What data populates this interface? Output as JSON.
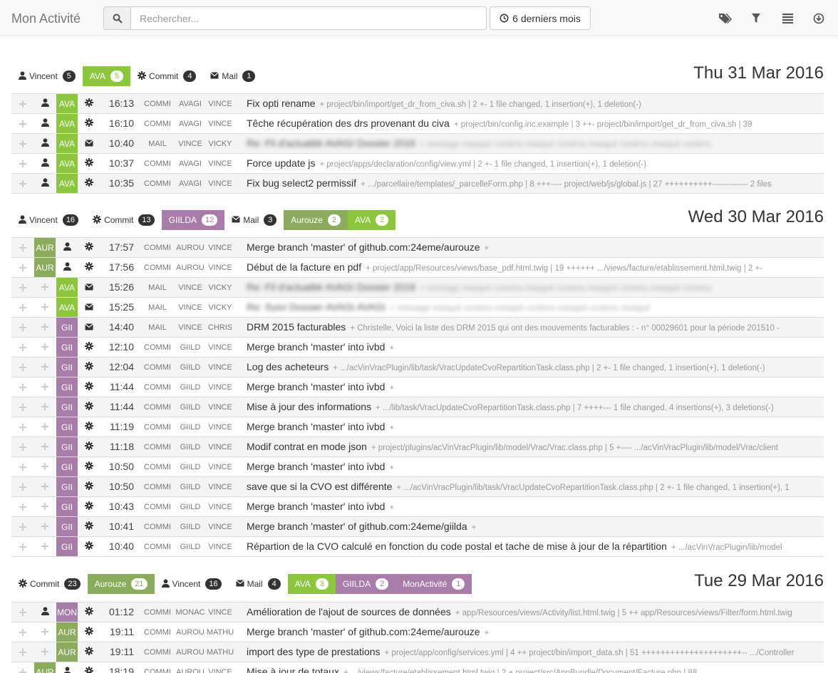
{
  "colors": {
    "AVA": "#8cc63f",
    "AUR": "#8aac5c",
    "GII": "#a87ca8",
    "MON": "#a87ca8"
  },
  "navbar": {
    "brand": "Mon Activité",
    "search_placeholder": "Rechercher...",
    "period_label": "6 derniers mois",
    "icons": [
      "tags-icon",
      "filter-icon",
      "list-icon",
      "download-icon"
    ]
  },
  "sections": [
    {
      "date": "Thu 31 Mar 2016",
      "summary": [
        {
          "icon": "user-icon",
          "label": "Vincent",
          "count": "5",
          "color": ""
        },
        {
          "icon": "",
          "label": "AVA",
          "count": "5",
          "color": "#8cc63f"
        },
        {
          "icon": "gear-icon",
          "label": "Commit",
          "count": "4",
          "color": ""
        },
        {
          "icon": "mail-icon",
          "label": "Mail",
          "count": "1",
          "color": ""
        }
      ],
      "rows": [
        {
          "cols": [
            "user",
            "AVA",
            "gear"
          ],
          "time": "16:13",
          "t1": "COMMI",
          "t2": "AVAGI",
          "t3": "VINCE",
          "title": "Fix opti rename",
          "detail": "+ project/bin/import/get_dr_from_civa.sh | 2 +- 1 file changed, 1 insertion(+), 1 deletion(-)",
          "blur": false
        },
        {
          "cols": [
            "user",
            "AVA",
            "gear"
          ],
          "time": "16:10",
          "t1": "COMMI",
          "t2": "AVAGI",
          "t3": "VINCE",
          "title": "Têche récupération des drs provenant du civa",
          "detail": "+ project/bin/config.inc.example | 3 ++- project/bin/import/get_dr_from_civa.sh | 39",
          "blur": false
        },
        {
          "cols": [
            "user",
            "AVA",
            "mail"
          ],
          "time": "10:40",
          "t1": "MAIL",
          "t2": "VINCE",
          "t3": "VICKY",
          "title": "Re: Fil d'actualité AVAGI Dossier 2016",
          "detail": "+ message masqué contenu masqué contenu masqué contenu masqué contenu",
          "blur": true
        },
        {
          "cols": [
            "user",
            "AVA",
            "gear"
          ],
          "time": "10:37",
          "t1": "COMMI",
          "t2": "AVAGI",
          "t3": "VINCE",
          "title": "Force update js",
          "detail": "+ project/apps/declaration/config/view.yml | 2 +- 1 file changed, 1 insertion(+), 1 deletion(-)",
          "blur": false
        },
        {
          "cols": [
            "user",
            "AVA",
            "gear"
          ],
          "time": "10:35",
          "t1": "COMMI",
          "t2": "AVAGI",
          "t3": "VINCE",
          "title": "Fix bug select2 permissif",
          "detail": "+ .../parcellaire/templates/_parcelleForm.php | 8 +++---- project/web/js/global.js | 27 ++++++++++------------- 2 files",
          "blur": false
        }
      ]
    },
    {
      "date": "Wed 30 Mar 2016",
      "summary": [
        {
          "icon": "user-icon",
          "label": "Vincent",
          "count": "16",
          "color": ""
        },
        {
          "icon": "gear-icon",
          "label": "Commit",
          "count": "13",
          "color": ""
        },
        {
          "icon": "",
          "label": "GIILDA",
          "count": "12",
          "color": "#a87ca8"
        },
        {
          "icon": "mail-icon",
          "label": "Mail",
          "count": "3",
          "color": ""
        },
        {
          "icon": "",
          "label": "Aurouze",
          "count": "2",
          "color": "#8aac5c"
        },
        {
          "icon": "",
          "label": "AVA",
          "count": "2",
          "color": "#8cc63f"
        }
      ],
      "rows": [
        {
          "cols": [
            "AUR",
            "user",
            "gear"
          ],
          "time": "17:57",
          "t1": "COMMI",
          "t2": "AUROU",
          "t3": "VINCE",
          "title": "Merge branch 'master' of github.com:24eme/aurouze",
          "detail": "+",
          "blur": false
        },
        {
          "cols": [
            "AUR",
            "user",
            "gear"
          ],
          "time": "17:56",
          "t1": "COMMI",
          "t2": "AUROU",
          "t3": "VINCE",
          "title": "Début de la facture en pdf",
          "detail": "+ project/app/Resources/views/base_pdf.html.twig | 19 ++++++ .../views/facture/etablissement.html.twig | 2 +-",
          "blur": false
        },
        {
          "cols": [
            "plus",
            "AVA",
            "mail"
          ],
          "time": "15:26",
          "t1": "MAIL",
          "t2": "VINCE",
          "t3": "VICKY",
          "title": "Re: Fil d'actualité AVAGI Dossier 2016",
          "detail": "+ message masqué contenu masqué contenu masqué contenu masqué contenu",
          "blur": true
        },
        {
          "cols": [
            "plus",
            "AVA",
            "mail"
          ],
          "time": "15:25",
          "t1": "MAIL",
          "t2": "VINCE",
          "t3": "VICKY",
          "title": "Re: Suivi Dossier AVAGI AVAGI",
          "detail": "+ message masqué contenu masqué contenu masqué contenu masqué",
          "blur": true
        },
        {
          "cols": [
            "plus",
            "GII",
            "mail"
          ],
          "time": "14:40",
          "t1": "MAIL",
          "t2": "VINCE",
          "t3": "CHRIS",
          "title": "DRM 2015 facturables",
          "detail": "+ Christelle, Voici la liste des DRM 2015 qui ont des mouvements facturables : - n° 00029601 pour la période 201510 -",
          "blur": false
        },
        {
          "cols": [
            "plus",
            "GII",
            "gear"
          ],
          "time": "12:10",
          "t1": "COMMI",
          "t2": "GIILD",
          "t3": "VINCE",
          "title": "Merge branch 'master' into ivbd",
          "detail": "+",
          "blur": false
        },
        {
          "cols": [
            "plus",
            "GII",
            "gear"
          ],
          "time": "12:04",
          "t1": "COMMI",
          "t2": "GIILD",
          "t3": "VINCE",
          "title": "Log des acheteurs",
          "detail": "+ .../acVinVracPlugin/lib/task/VracUpdateCvoRepartitionTask.class.php | 2 +- 1 file changed, 1 insertion(+), 1 deletion(-)",
          "blur": false
        },
        {
          "cols": [
            "plus",
            "GII",
            "gear"
          ],
          "time": "11:44",
          "t1": "COMMI",
          "t2": "GIILD",
          "t3": "VINCE",
          "title": "Merge branch 'master' into ivbd",
          "detail": "+",
          "blur": false
        },
        {
          "cols": [
            "plus",
            "GII",
            "gear"
          ],
          "time": "11:44",
          "t1": "COMMI",
          "t2": "GIILD",
          "t3": "VINCE",
          "title": "Mise à jour des informations",
          "detail": "+ .../lib/task/VracUpdateCvoRepartitionTask.class.php | 7 ++++--- 1 file changed, 4 insertions(+), 3 deletions(-)",
          "blur": false
        },
        {
          "cols": [
            "plus",
            "GII",
            "gear"
          ],
          "time": "11:19",
          "t1": "COMMI",
          "t2": "GIILD",
          "t3": "VINCE",
          "title": "Merge branch 'master' into ivbd",
          "detail": "+",
          "blur": false
        },
        {
          "cols": [
            "plus",
            "GII",
            "gear"
          ],
          "time": "11:18",
          "t1": "COMMI",
          "t2": "GIILD",
          "t3": "VINCE",
          "title": "Modif contrat en mode json",
          "detail": "+ project/plugins/acVinVracPlugin/lib/model/Vrac/Vrac.class.php | 5 +---- .../acVinVracPlugin/lib/model/Vrac/client",
          "blur": false
        },
        {
          "cols": [
            "plus",
            "GII",
            "gear"
          ],
          "time": "10:50",
          "t1": "COMMI",
          "t2": "GIILD",
          "t3": "VINCE",
          "title": "Merge branch 'master' into ivbd",
          "detail": "+",
          "blur": false
        },
        {
          "cols": [
            "plus",
            "GII",
            "gear"
          ],
          "time": "10:50",
          "t1": "COMMI",
          "t2": "GIILD",
          "t3": "VINCE",
          "title": "save que si la CVO est différente",
          "detail": "+ .../acVinVracPlugin/lib/task/VracUpdateCvoRepartitionTask.class.php | 2 +- 1 file changed, 1 insertion(+), 1",
          "blur": false
        },
        {
          "cols": [
            "plus",
            "GII",
            "gear"
          ],
          "time": "10:43",
          "t1": "COMMI",
          "t2": "GIILD",
          "t3": "VINCE",
          "title": "Merge branch 'master' into ivbd",
          "detail": "+",
          "blur": false
        },
        {
          "cols": [
            "plus",
            "GII",
            "gear"
          ],
          "time": "10:41",
          "t1": "COMMI",
          "t2": "GIILD",
          "t3": "VINCE",
          "title": "Merge branch 'master' of github.com:24eme/giilda",
          "detail": "+",
          "blur": false
        },
        {
          "cols": [
            "plus",
            "GII",
            "gear"
          ],
          "time": "10:40",
          "t1": "COMMI",
          "t2": "GIILD",
          "t3": "VINCE",
          "title": "Répartion de la CVO calculé en fonction du code postal et tache de mise à jour de la répartition",
          "detail": "+ .../acVinVracPlugin/lib/model",
          "blur": false
        }
      ]
    },
    {
      "date": "Tue 29 Mar 2016",
      "summary": [
        {
          "icon": "gear-icon",
          "label": "Commit",
          "count": "23",
          "color": ""
        },
        {
          "icon": "",
          "label": "Aurouze",
          "count": "21",
          "color": "#8aac5c"
        },
        {
          "icon": "user-icon",
          "label": "Vincent",
          "count": "16",
          "color": ""
        },
        {
          "icon": "mail-icon",
          "label": "Mail",
          "count": "4",
          "color": ""
        },
        {
          "icon": "",
          "label": "AVA",
          "count": "3",
          "color": "#8cc63f"
        },
        {
          "icon": "",
          "label": "GIILDA",
          "count": "2",
          "color": "#a87ca8"
        },
        {
          "icon": "",
          "label": "MonActivité",
          "count": "1",
          "color": "#a87ca8"
        }
      ],
      "rows": [
        {
          "cols": [
            "user",
            "MON",
            "gear"
          ],
          "time": "01:12",
          "t1": "COMMI",
          "t2": "MONAC",
          "t3": "VINCE",
          "title": "Amélioration de l'ajout de sources de données",
          "detail": "+ app/Resources/views/Activity/list.html.twig | 5 ++ app/Resources/views/Filter/form.html.twig",
          "blur": false
        },
        {
          "cols": [
            "plus",
            "AUR",
            "gear"
          ],
          "time": "19:11",
          "t1": "COMMI",
          "t2": "AUROU",
          "t3": "MATHU",
          "title": "Merge branch 'master' of github.com:24eme/aurouze",
          "detail": "+",
          "blur": false
        },
        {
          "cols": [
            "plus",
            "AUR",
            "gear"
          ],
          "time": "19:11",
          "t1": "COMMI",
          "t2": "AUROU",
          "t3": "MATHU",
          "title": "import des type de prestations",
          "detail": "+ project/app/config/services.yml | 4 ++ project/bin/import_data.sh | 51 +++++++++++++++++++++-- .../Controller",
          "blur": false
        },
        {
          "cols": [
            "AUR",
            "user",
            "gear"
          ],
          "time": "18:19",
          "t1": "COMMI",
          "t2": "AUROU",
          "t3": "VINCE",
          "title": "Mise à jour de totaux",
          "detail": "+ .../views/facture/etablissement.html.twig | 2 + project/src/AppBundle/Document/Facture.php | 88",
          "blur": false
        }
      ]
    }
  ]
}
